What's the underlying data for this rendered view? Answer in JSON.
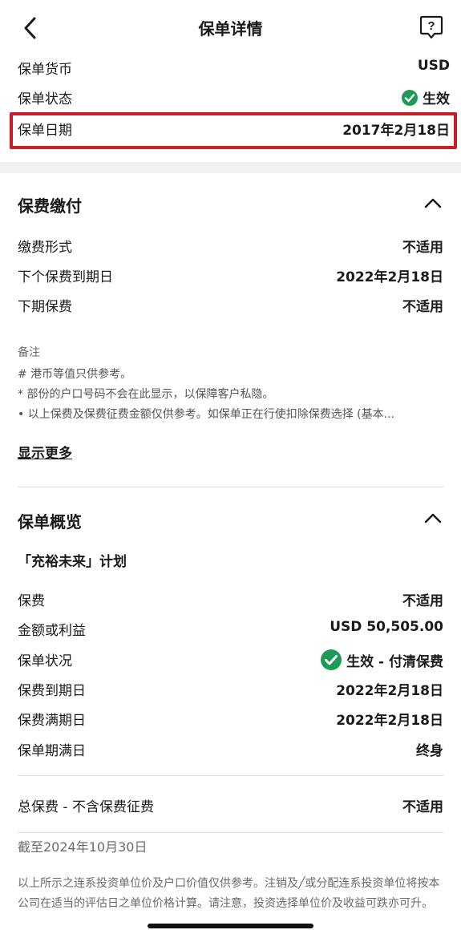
{
  "header": {
    "title": "保单详情"
  },
  "policy_info": [
    {
      "label": "保单货币",
      "value": "USD"
    },
    {
      "label": "保单状态",
      "value": "生效"
    },
    {
      "label": "保单日期",
      "value": "2017年2月18日"
    }
  ],
  "premium_payment": {
    "title": "保费缴付",
    "rows": [
      {
        "label": "缴费形式",
        "value": "不适用"
      },
      {
        "label": "下个保费到期日",
        "value": "2022年2月18日"
      },
      {
        "label": "下期保费",
        "value": "不适用"
      }
    ],
    "notes_title": "备注",
    "notes": [
      "# 港币等值只供参考。",
      "* 部份的户口号码不会在此显示，以保障客户私隐。",
      "• 以上保费及保费征费金额仅供参考。如保单正在行使扣除保费选择 (基本..."
    ],
    "show_more": "显示更多"
  },
  "policy_overview": {
    "title": "保单概览",
    "plan_name": "「充裕未来」计划",
    "rows": [
      {
        "label": "保费",
        "value": "不适用"
      },
      {
        "label": "金额或利益",
        "value": "USD 50,505.00"
      },
      {
        "label": "保单状况",
        "value": "生效 - 付清保费"
      },
      {
        "label": "保费到期日",
        "value": "2022年2月18日"
      },
      {
        "label": "保费满期日",
        "value": "2022年2月18日"
      },
      {
        "label": "保单期满日",
        "value": "终身"
      }
    ],
    "total": {
      "label": "总保费 - 不含保费征费",
      "value": "不适用"
    },
    "as_of": "截至2024年10月30日",
    "disclaimer": "以上所示之连系投资单位价及户口价值仅供参考。注销及╱或分配连系投资单位将按本公司在适当的评估日之单位价格计算。请注意，投资选择单位价及收益可跌亦可升。"
  },
  "colors": {
    "accent_green": "#1e9a58",
    "highlight_red": "#c81e28"
  },
  "icons": {
    "back": "chevron-left-icon",
    "help": "help-bubble-icon",
    "collapse": "chevron-up-icon",
    "status": "check-circle-icon"
  }
}
